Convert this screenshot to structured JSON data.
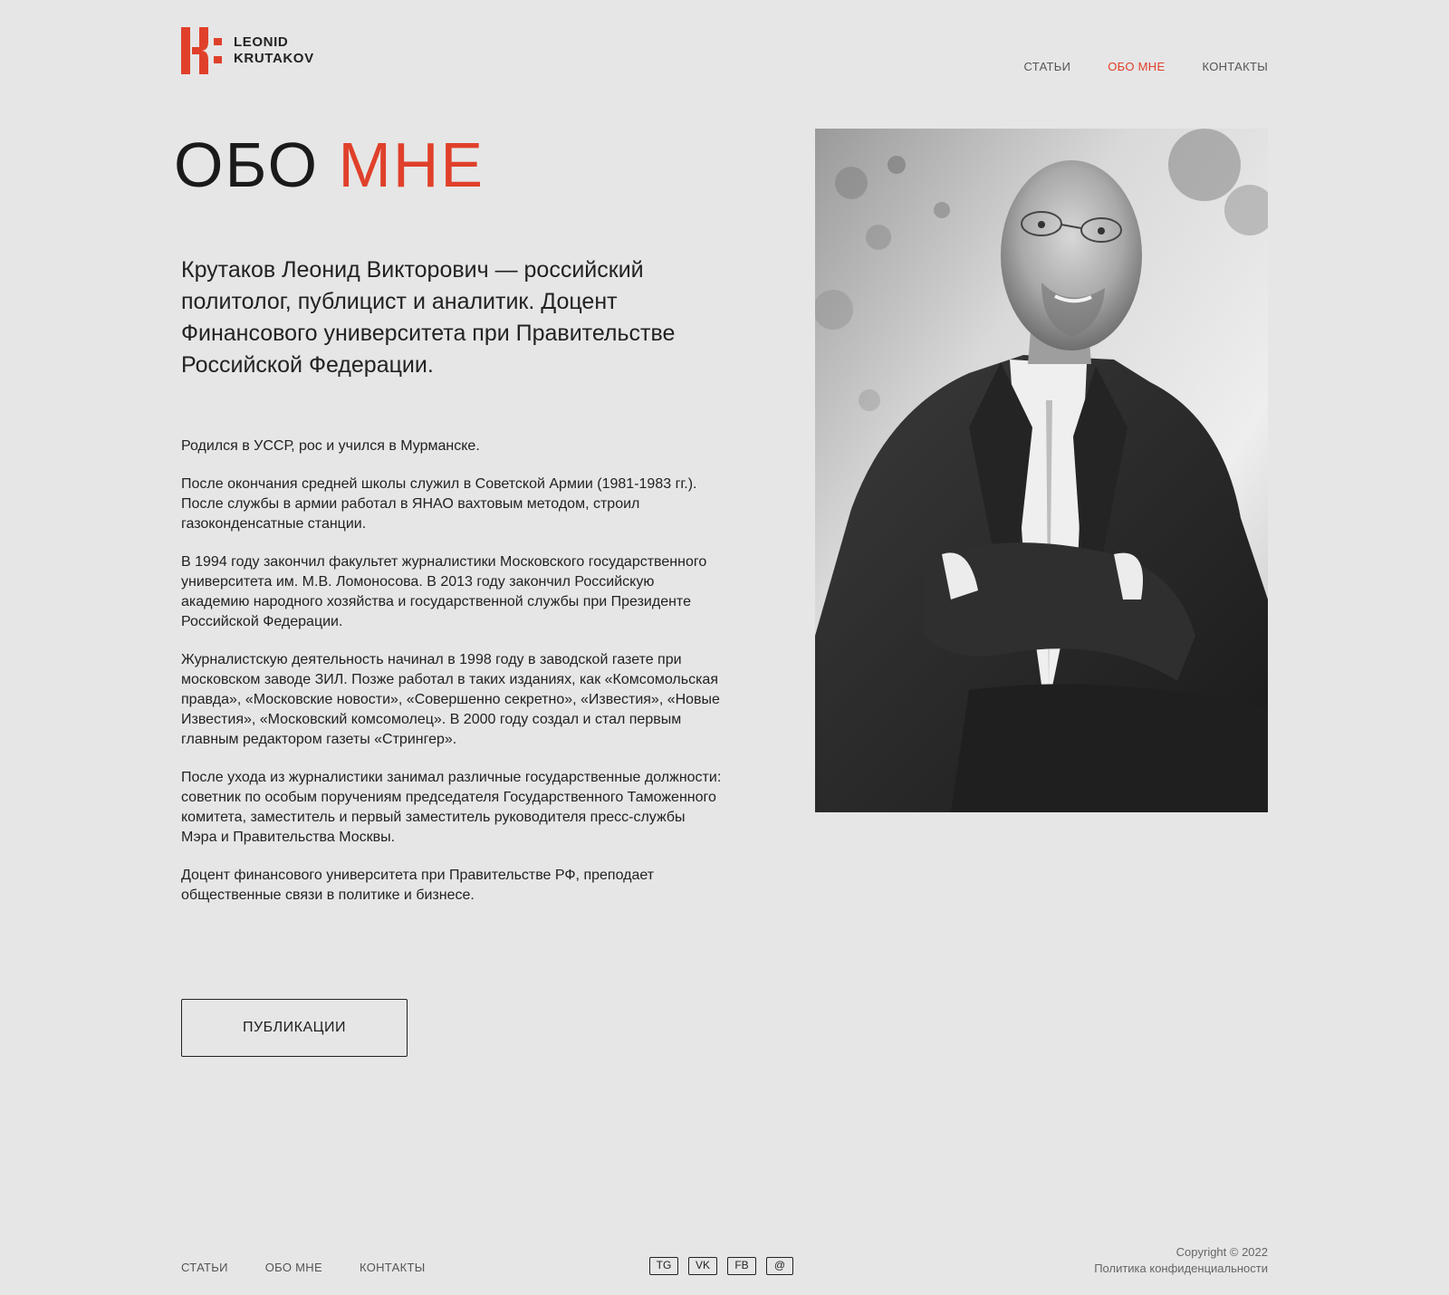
{
  "header": {
    "logo_line1": "LEONID",
    "logo_line2": "KRUTAKOV",
    "nav": [
      {
        "label": "СТАТЬИ",
        "active": false
      },
      {
        "label": "ОБО МНЕ",
        "active": true
      },
      {
        "label": "КОНТАКТЫ",
        "active": false
      }
    ]
  },
  "main": {
    "title_part1": "ОБО",
    "title_part2": "МНЕ",
    "lead": "Крутаков Леонид Викторович — российский политолог, публицист и аналитик. Доцент Финансового университета при Правительстве Российской Федерации.",
    "bio": [
      "Родился в УССР, рос и учился в Мурманске.",
      "После окончания средней школы служил в Советской Армии (1981-1983 гг.). После службы в армии работал в ЯНАО вахтовым методом, строил газоконденсатные станции.",
      "В 1994 году закончил факультет журналистики Московского государственного университета им. М.В. Ломоносова. В 2013 году закончил Российскую академию народного хозяйства и государственной службы при Президенте Российской Федерации.",
      "Журналистскую деятельность начинал в 1998 году в заводской газете при московском заводе ЗИЛ. Позже работал в таких изданиях, как «Комсомольская правда», «Московские новости», «Совершенно секретно», «Известия», «Новые Известия», «Московский комсомолец». В 2000 году создал и стал первым главным редактором газеты «Стрингер».",
      "После ухода из журналистики занимал различные государственные должности: советник по особым поручениям председателя Государственного Таможенного комитета, заместитель и первый заместитель руководителя пресс-службы Мэра и Правительства Москвы.",
      "Доцент финансового университета при Правительстве РФ, преподает общественные связи в политике и бизнесе."
    ],
    "publications_button": "ПУБЛИКАЦИИ",
    "photo_icon": "portrait-photo"
  },
  "footer": {
    "nav": [
      "СТАТЬИ",
      "ОБО МНЕ",
      "КОНТАКТЫ"
    ],
    "social": [
      "TG",
      "VK",
      "FB",
      "@"
    ],
    "copyright": "Copyright © 2022",
    "privacy": "Политика конфиденциальности"
  },
  "colors": {
    "background": "#e6e6e6",
    "accent": "#e0402a",
    "text": "#1e1e1e"
  }
}
